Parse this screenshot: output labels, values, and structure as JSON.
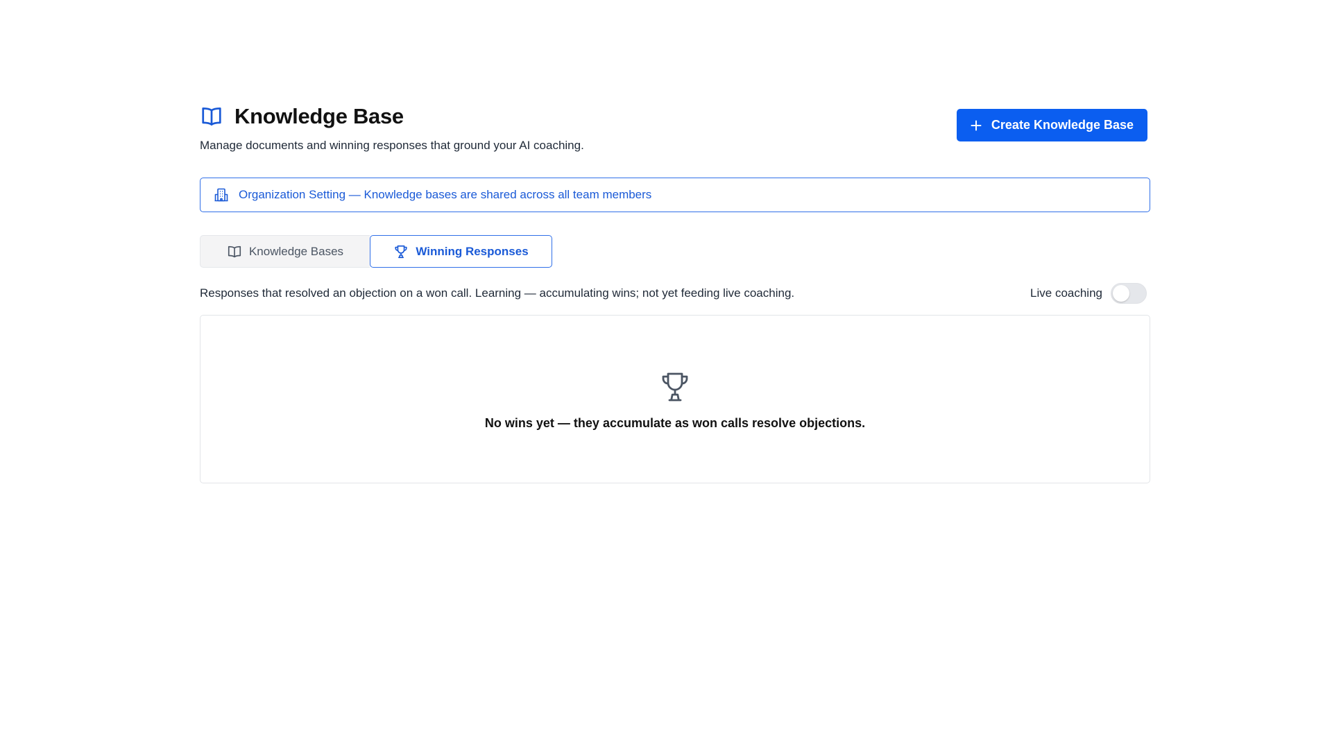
{
  "header": {
    "title": "Knowledge Base",
    "subtitle": "Manage documents and winning responses that ground your AI coaching.",
    "icon": "book-icon",
    "create_button_label": "Create Knowledge Base"
  },
  "org_banner": {
    "icon": "building-icon",
    "text": "Organization Setting — Knowledge bases are shared across all team members"
  },
  "tabs": [
    {
      "label": "Knowledge Bases",
      "icon": "book-icon",
      "active": false
    },
    {
      "label": "Winning Responses",
      "icon": "trophy-icon",
      "active": true
    }
  ],
  "winning_responses": {
    "description": "Responses that resolved an objection on a won call. Learning — accumulating wins; not yet feeding live coaching.",
    "live_coaching_label": "Live coaching",
    "live_coaching_enabled": false,
    "empty_state_text": "No wins yet — they accumulate as won calls resolve objections.",
    "empty_state_icon": "trophy-icon"
  },
  "colors": {
    "accent": "#0b5ef0",
    "accent_text": "#1a5ad7",
    "border": "#e2e4e8"
  }
}
